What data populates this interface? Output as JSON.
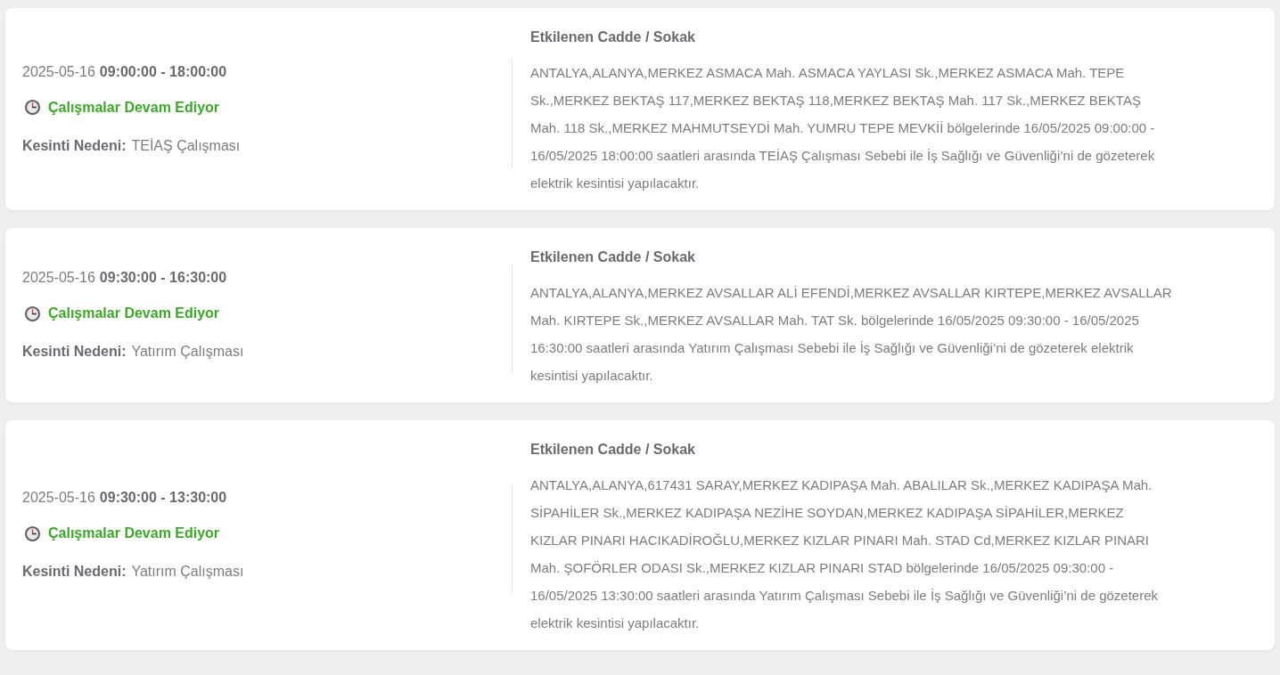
{
  "outages": [
    {
      "date": "2025-05-16",
      "time_range": "09:00:00 - 18:00:00",
      "status": {
        "kind": "ongoing",
        "label": "Çalışmalar Devam Ediyor"
      },
      "reason_label": "Kesinti Nedeni:",
      "reason": "TEİAŞ Çalışması",
      "streets_heading": "Etkilenen Cadde / Sokak",
      "streets": "ANTALYA,ALANYA,MERKEZ ASMACA Mah. ASMACA YAYLASI Sk.,MERKEZ ASMACA Mah. TEPE Sk.,MERKEZ BEKTAŞ 117,MERKEZ BEKTAŞ 118,MERKEZ BEKTAŞ Mah. 117 Sk.,MERKEZ BEKTAŞ Mah. 118 Sk.,MERKEZ MAHMUTSEYDİ Mah. YUMRU TEPE MEVKİİ bölgelerinde 16/05/2025 09:00:00 - 16/05/2025 18:00:00 saatleri arasında TEİAŞ Çalışması Sebebi ile İş Sağlığı ve Güvenliği’ni de gözeterek elektrik kesintisi yapılacaktır."
    },
    {
      "date": "2025-05-16",
      "time_range": "09:30:00 - 16:30:00",
      "status": {
        "kind": "ongoing",
        "label": "Çalışmalar Devam Ediyor"
      },
      "reason_label": "Kesinti Nedeni:",
      "reason": "Yatırım Çalışması",
      "streets_heading": "Etkilenen Cadde / Sokak",
      "streets": "ANTALYA,ALANYA,MERKEZ AVSALLAR ALİ EFENDİ,MERKEZ AVSALLAR KIRTEPE,MERKEZ AVSALLAR Mah. KIRTEPE Sk.,MERKEZ AVSALLAR Mah. TAT Sk. bölgelerinde 16/05/2025 09:30:00 - 16/05/2025 16:30:00 saatleri arasında Yatırım Çalışması Sebebi ile İş Sağlığı ve Güvenliği’ni de gözeterek elektrik kesintisi yapılacaktır."
    },
    {
      "date": "2025-05-16",
      "time_range": "09:30:00 - 13:30:00",
      "status": {
        "kind": "ongoing",
        "label": "Çalışmalar Devam Ediyor"
      },
      "reason_label": "Kesinti Nedeni:",
      "reason": "Yatırım Çalışması",
      "streets_heading": "Etkilenen Cadde / Sokak",
      "streets": "ANTALYA,ALANYA,617431 SARAY,MERKEZ KADIPAŞA Mah. ABALILAR Sk.,MERKEZ KADIPAŞA Mah. SİPAHİLER Sk.,MERKEZ KADIPAŞA NEZİHE SOYDAN,MERKEZ KADIPAŞA SİPAHİLER,MERKEZ KIZLAR PINARI HACIKADİROĞLU,MERKEZ KIZLAR PINARI Mah. STAD Cd,MERKEZ KIZLAR PINARI Mah. ŞOFÖRLER ODASI Sk.,MERKEZ KIZLAR PINARI STAD bölgelerinde 16/05/2025 09:30:00 - 16/05/2025 13:30:00 saatleri arasında Yatırım Çalışması Sebebi ile İş Sağlığı ve Güvenliği’ni de gözeterek elektrik kesintisi yapılacaktır."
    }
  ]
}
